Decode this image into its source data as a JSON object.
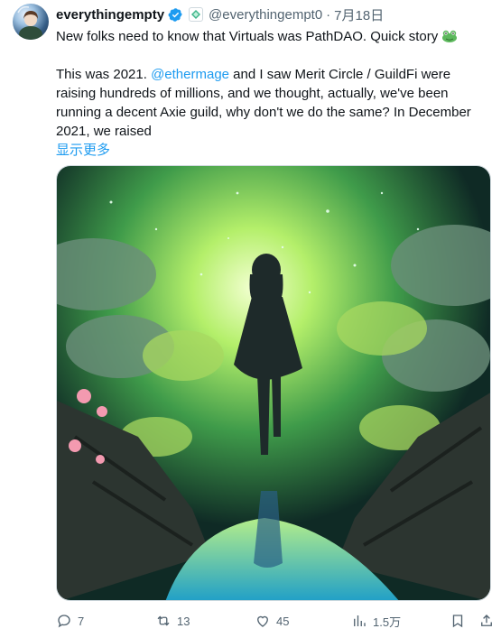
{
  "tweet": {
    "author_name": "everythingempty",
    "handle": "@everythingempt0",
    "separator": "·",
    "time": "7月18日",
    "line1": "New folks need to know that Virtuals was PathDAO. Quick story",
    "line2_pre": "This was 2021. ",
    "mention": "@ethermage",
    "line2_post": " and I saw Merit Circle / GuildFi were raising hundreds of millions, and we thought, actually, we've been running a decent Axie guild, why don't we do the same? In December 2021, we raised",
    "show_more": "显示更多"
  },
  "actions": {
    "replies": "7",
    "retweets": "13",
    "likes": "45",
    "views": "1.5万"
  },
  "icons": {
    "verified": "verified-badge-icon",
    "affiliate": "affiliate-badge-icon",
    "emoji": "frog-emoji-icon",
    "reply": "reply-icon",
    "retweet": "retweet-icon",
    "like": "heart-icon",
    "views": "views-icon",
    "bookmark": "bookmark-icon",
    "share": "share-icon"
  },
  "colors": {
    "link": "#1d9bf0",
    "muted": "#536471",
    "verified": "#1d9bf0"
  }
}
